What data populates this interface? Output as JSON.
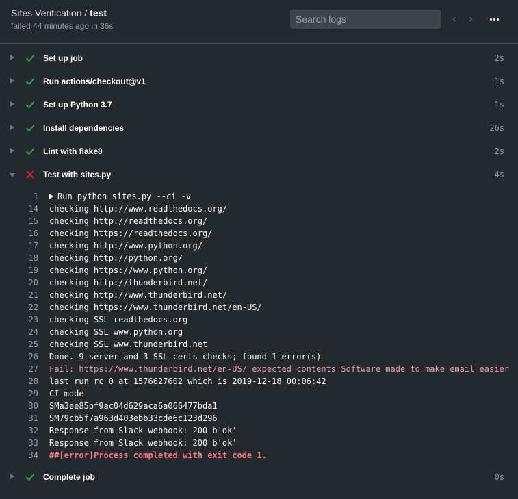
{
  "header": {
    "workflow": "Sites Verification",
    "separator": " / ",
    "job": "test",
    "status_text": "failed 44 minutes ago in 36s",
    "search_placeholder": "Search logs",
    "prev_icon": "chevron-left-icon",
    "next_icon": "chevron-right-icon",
    "more_icon": "kebab-horizontal-icon"
  },
  "colors": {
    "success": "#28a745",
    "failure": "#cb2431",
    "error_text": "#f97583"
  },
  "steps": [
    {
      "name": "Set up job",
      "duration": "2s",
      "status": "success",
      "expanded": false
    },
    {
      "name": "Run actions/checkout@v1",
      "duration": "1s",
      "status": "success",
      "expanded": false
    },
    {
      "name": "Set up Python 3.7",
      "duration": "1s",
      "status": "success",
      "expanded": false
    },
    {
      "name": "Install dependencies",
      "duration": "26s",
      "status": "success",
      "expanded": false
    },
    {
      "name": "Lint with flake8",
      "duration": "2s",
      "status": "success",
      "expanded": false
    },
    {
      "name": "Test with sites.py",
      "duration": "4s",
      "status": "failure",
      "expanded": true
    },
    {
      "name": "Complete job",
      "duration": "0s",
      "status": "success",
      "expanded": false
    }
  ],
  "log": [
    {
      "num": "1",
      "text": "Run python sites.py --ci -v",
      "kind": "group"
    },
    {
      "num": "14",
      "text": "checking http://www.readthedocs.org/",
      "kind": "normal"
    },
    {
      "num": "15",
      "text": "checking http://readthedocs.org/",
      "kind": "normal"
    },
    {
      "num": "16",
      "text": "checking https://readthedocs.org/",
      "kind": "normal"
    },
    {
      "num": "17",
      "text": "checking http://www.python.org/",
      "kind": "normal"
    },
    {
      "num": "18",
      "text": "checking http://python.org/",
      "kind": "normal"
    },
    {
      "num": "19",
      "text": "checking https://www.python.org/",
      "kind": "normal"
    },
    {
      "num": "20",
      "text": "checking http://thunderbird.net/",
      "kind": "normal"
    },
    {
      "num": "21",
      "text": "checking http://www.thunderbird.net/",
      "kind": "normal"
    },
    {
      "num": "22",
      "text": "checking https://www.thunderbird.net/en-US/",
      "kind": "normal"
    },
    {
      "num": "23",
      "text": "checking SSL readthedocs.org",
      "kind": "normal"
    },
    {
      "num": "24",
      "text": "checking SSL www.python.org",
      "kind": "normal"
    },
    {
      "num": "25",
      "text": "checking SSL www.thunderbird.net",
      "kind": "normal"
    },
    {
      "num": "26",
      "text": "Done. 9 server and 3 SSL certs checks; found 1 error(s)",
      "kind": "normal"
    },
    {
      "num": "27",
      "text": "Fail: https://www.thunderbird.net/en-US/ expected contents Software made to make email easier",
      "kind": "fail"
    },
    {
      "num": "28",
      "text": "last run rc 0 at 1576627602 which is 2019-12-18 00:06:42",
      "kind": "normal"
    },
    {
      "num": "29",
      "text": "CI mode",
      "kind": "normal"
    },
    {
      "num": "30",
      "text": "SMa3ee85bf9ac04d629aca6a066477bda1",
      "kind": "normal"
    },
    {
      "num": "31",
      "text": "SM79cb5f7a963d403ebb33cde6c123d296",
      "kind": "normal"
    },
    {
      "num": "32",
      "text": "Response from Slack webhook: 200 b'ok'",
      "kind": "normal"
    },
    {
      "num": "33",
      "text": "Response from Slack webhook: 200 b'ok'",
      "kind": "normal"
    },
    {
      "num": "34",
      "text": "##[error]Process completed with exit code 1.",
      "kind": "error"
    }
  ]
}
